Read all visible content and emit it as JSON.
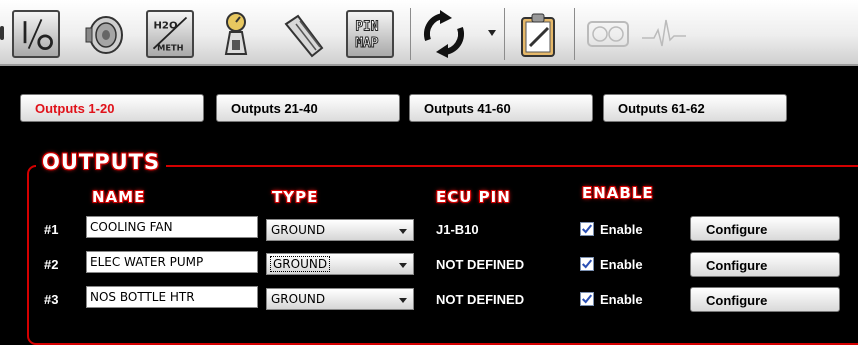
{
  "toolbar": {
    "icons": [
      "io-toggle-icon",
      "sensor-icon",
      "h2o-meth-icon",
      "gauge-dial-icon",
      "throttle-pedal-icon",
      "pin-map-icon",
      "sync-icon",
      "clipboard-notes-icon",
      "dashboard-gauges-icon",
      "waveform-icon"
    ],
    "h2o_label": "H2O",
    "meth_label": "METH",
    "pin_label": "PIN",
    "map_label": "MAP"
  },
  "tabs": [
    {
      "label": "Outputs 1-20",
      "active": true
    },
    {
      "label": "Outputs 21-40",
      "active": false
    },
    {
      "label": "Outputs 41-60",
      "active": false
    },
    {
      "label": "Outputs 61-62",
      "active": false
    }
  ],
  "panel": {
    "title": "OUTPUTS",
    "headers": {
      "name": "NAME",
      "type": "TYPE",
      "ecu_pin": "ECU PIN",
      "enable": "ENABLE"
    }
  },
  "rows": [
    {
      "num": "#1",
      "name": "COOLING FAN",
      "type": "GROUND",
      "ecu_pin": "J1-B10",
      "enabled": true,
      "enable_label": "Enable",
      "configure_label": "Configure"
    },
    {
      "num": "#2",
      "name": "ELEC WATER PUMP",
      "type": "GROUND",
      "ecu_pin": "NOT DEFINED",
      "enabled": true,
      "enable_label": "Enable",
      "configure_label": "Configure"
    },
    {
      "num": "#3",
      "name": "NOS BOTTLE HTR",
      "type": "GROUND",
      "ecu_pin": "NOT DEFINED",
      "enabled": true,
      "enable_label": "Enable",
      "configure_label": "Configure"
    }
  ],
  "colors": {
    "accent": "#e0121a",
    "panel_border": "#d40000",
    "checkbox": "#2a4fb4"
  }
}
